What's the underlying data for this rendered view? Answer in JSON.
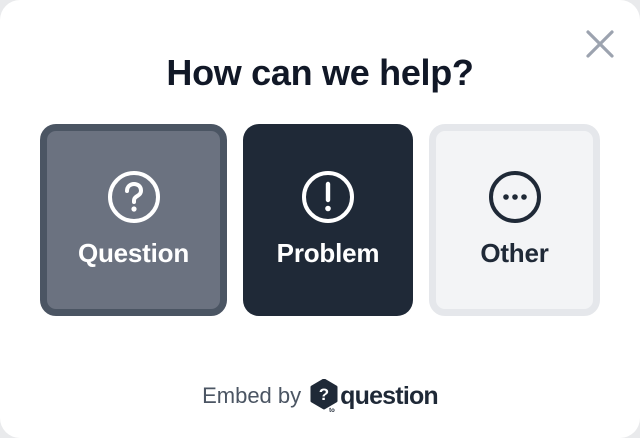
{
  "modal": {
    "title": "How can we help?",
    "close_icon": "close-icon"
  },
  "options": [
    {
      "label": "Question",
      "icon": "question-circle-icon"
    },
    {
      "label": "Problem",
      "icon": "exclamation-circle-icon"
    },
    {
      "label": "Other",
      "icon": "ellipsis-circle-icon"
    }
  ],
  "footer": {
    "embed_text": "Embed by",
    "brand_name": "question",
    "brand_mark_text": "?",
    "brand_mark_sub": "to"
  },
  "colors": {
    "title": "#111827",
    "question_bg": "#6b7280",
    "problem_bg": "#1f2937",
    "other_bg": "#f3f4f6"
  }
}
